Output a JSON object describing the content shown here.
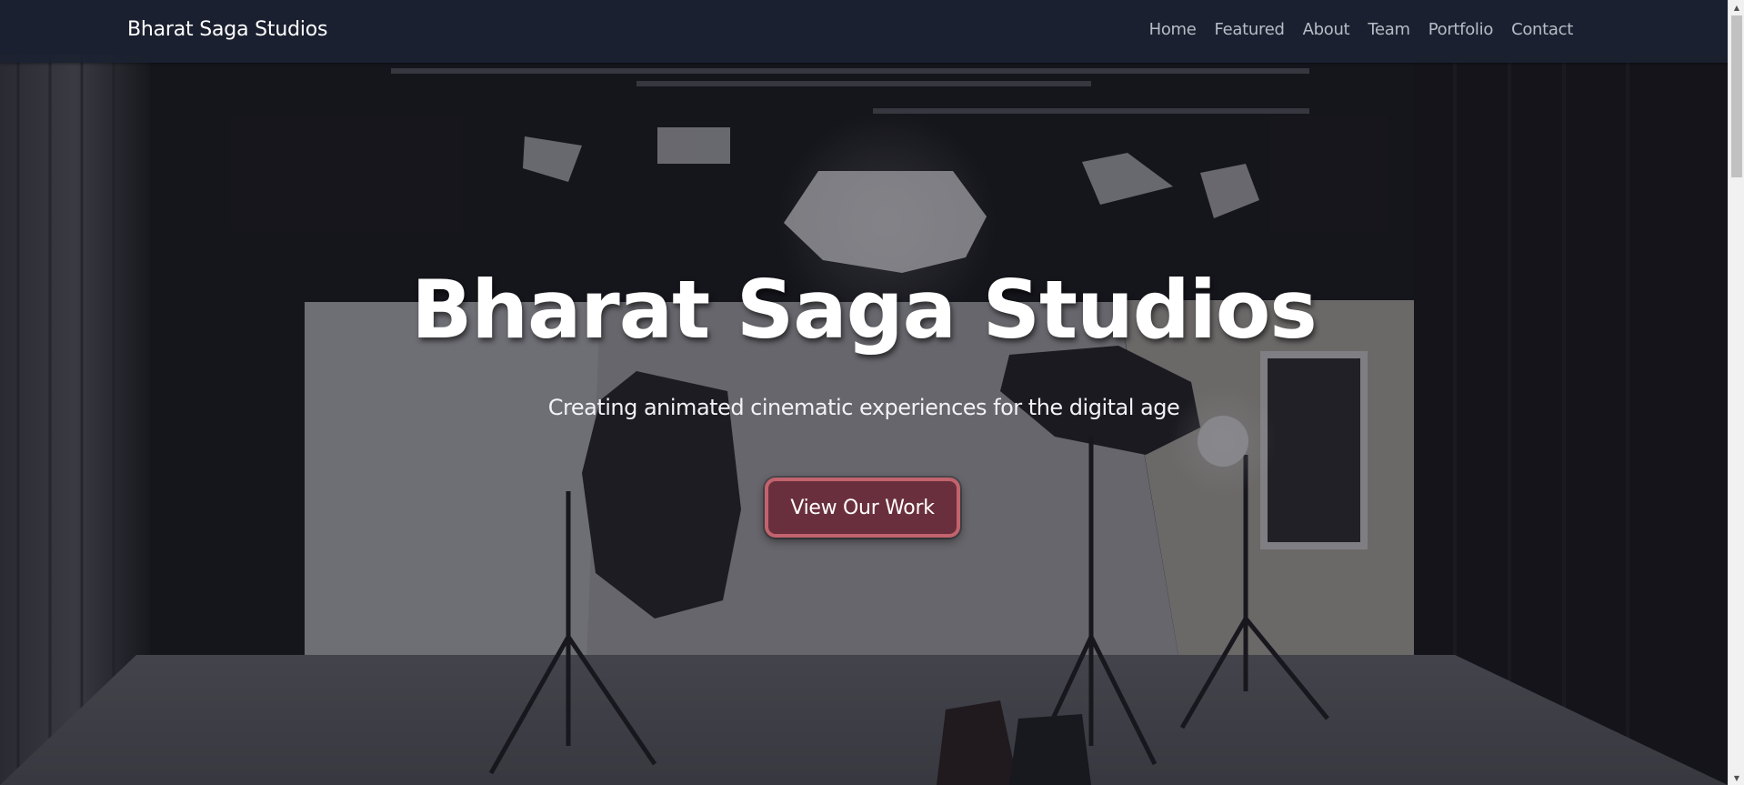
{
  "navbar": {
    "brand": "Bharat Saga Studios",
    "links": [
      "Home",
      "Featured",
      "About",
      "Team",
      "Portfolio",
      "Contact"
    ]
  },
  "hero": {
    "title": "Bharat Saga Studios",
    "subtitle": "Creating animated cinematic experiences for the digital age",
    "cta_label": "View Our Work",
    "background_image": "photo-studio-with-softboxes-and-light-stands"
  },
  "colors": {
    "navbar_bg": "#1b2130",
    "nav_link": "#b7bcc6",
    "cta_bg": "#6a2f3d",
    "cta_border": "#c2636d",
    "text": "#ffffff"
  },
  "icons": {
    "scroll_up": "scroll-up-arrow-icon",
    "scroll_down": "scroll-down-arrow-icon"
  }
}
